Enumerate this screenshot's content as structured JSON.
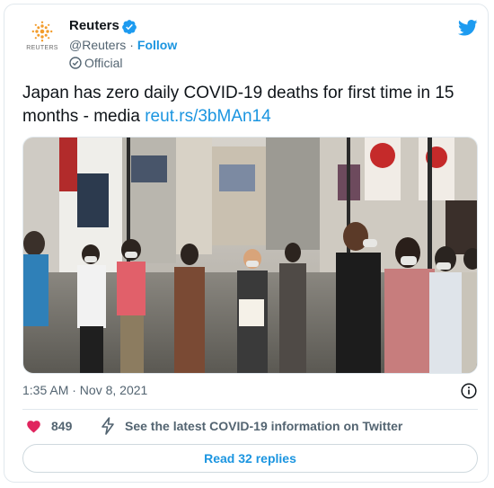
{
  "account": {
    "name": "Reuters",
    "logo_text": "REUTERS",
    "handle": "@Reuters",
    "separator": "·",
    "follow_label": "Follow",
    "official_label": "Official"
  },
  "tweet": {
    "text": "Japan has zero daily COVID-19 deaths for first time in 15 months - media",
    "link": "reut.rs/3bMAn14",
    "timestamp": "1:35 AM · Nov 8, 2021"
  },
  "actions": {
    "likes": "849",
    "info_link": "See the latest COVID-19 information on Twitter",
    "replies_button": "Read 32 replies"
  },
  "colors": {
    "link": "#1b95e0",
    "heart": "#e0245e",
    "logo": "#f39c2b"
  },
  "icons": [
    "verified-badge-icon",
    "twitter-bird-icon",
    "official-icon",
    "info-icon",
    "heart-icon",
    "lightning-icon"
  ]
}
